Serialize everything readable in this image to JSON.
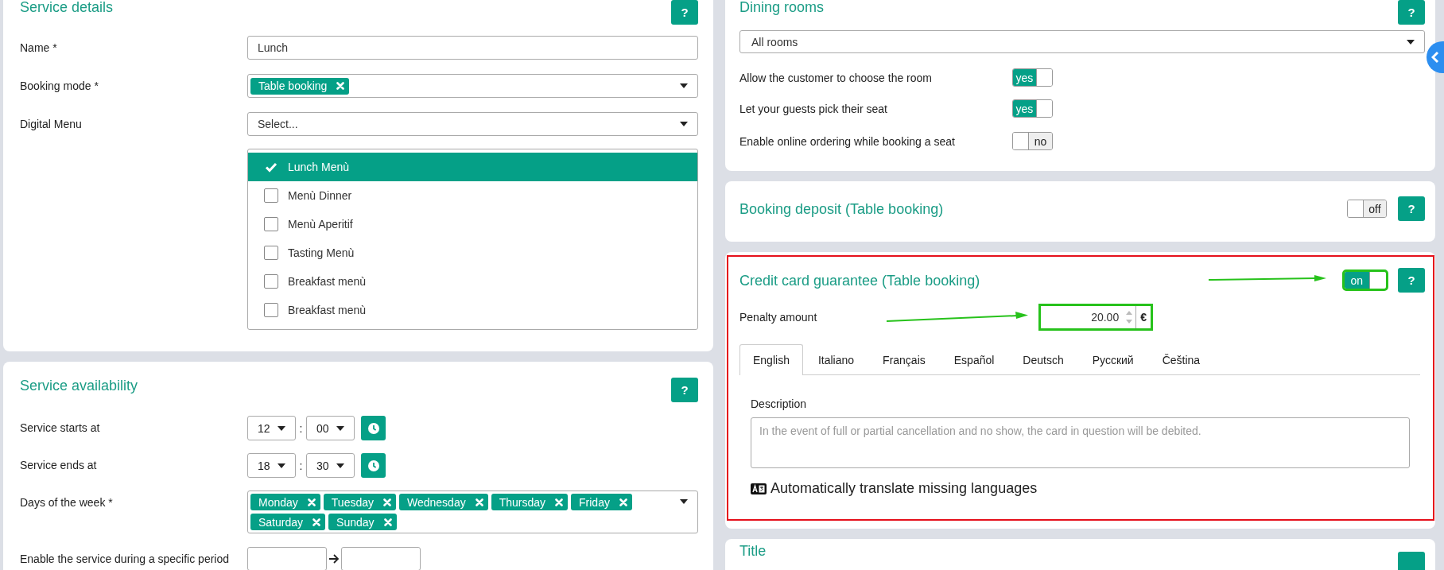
{
  "service_details": {
    "title": "Service details",
    "help": "?",
    "fields": [
      {
        "kind": "text",
        "label": "Name *",
        "value": "Lunch"
      },
      {
        "kind": "tags",
        "label": "Booking mode *",
        "tags": [
          "Table booking"
        ]
      },
      {
        "kind": "select",
        "label": "Digital Menu",
        "placeholder": "Select..."
      }
    ],
    "menus": [
      {
        "label": "Lunch Menù",
        "checked": true,
        "selected": true
      },
      {
        "label": "Menù Dinner",
        "checked": false,
        "selected": false
      },
      {
        "label": "Menù Aperitif",
        "checked": false,
        "selected": false
      },
      {
        "label": "Tasting Menù",
        "checked": false,
        "selected": false
      },
      {
        "label": "Breakfast menù",
        "checked": false,
        "selected": false
      },
      {
        "label": "Breakfast menù",
        "checked": false,
        "selected": false
      }
    ]
  },
  "service_availability": {
    "title": "Service availability",
    "help": "?",
    "times": [
      {
        "label": "Service starts at",
        "hour": "12",
        "separator": ":",
        "minute": "00"
      },
      {
        "label": "Service ends at",
        "hour": "18",
        "separator": ":",
        "minute": "30"
      }
    ],
    "days": {
      "label": "Days of the week *",
      "tags": [
        "Monday",
        "Tuesday",
        "Wednesday",
        "Thursday",
        "Friday",
        "Saturday",
        "Sunday"
      ]
    },
    "period": {
      "label": "Enable the service during a specific period"
    }
  },
  "dining_rooms": {
    "title": "Dining rooms",
    "help": "?",
    "select": "All rooms",
    "toggles": [
      {
        "label": "Allow the customer to choose the room",
        "on": true,
        "text": "yes"
      },
      {
        "label": "Let your guests pick their seat",
        "on": true,
        "text": "yes"
      },
      {
        "label": "Enable online ordering while booking a seat",
        "on": false,
        "text": "no"
      }
    ]
  },
  "booking_deposit": {
    "title": "Booking deposit (Table booking)",
    "toggle": {
      "on": false,
      "text": "off"
    },
    "help": "?"
  },
  "credit_card_guarantee": {
    "title": "Credit card guarantee (Table booking)",
    "toggle": {
      "on": true,
      "text": "on",
      "annotated": true
    },
    "help": "?",
    "penalty": {
      "label": "Penalty amount",
      "value": "20.00",
      "currency": "€",
      "annotated": true
    },
    "tabs": [
      {
        "label": "English",
        "selected": true
      },
      {
        "label": "Italiano",
        "selected": false
      },
      {
        "label": "Français",
        "selected": false
      },
      {
        "label": "Español",
        "selected": false
      },
      {
        "label": "Deutsch",
        "selected": false
      },
      {
        "label": "Русский",
        "selected": false
      },
      {
        "label": "Čeština",
        "selected": false
      }
    ],
    "description": {
      "label": "Description",
      "placeholder": "In the event of full or partial cancellation and no show, the card in question will be debited."
    },
    "auto_translate": "Automatically translate missing languages"
  },
  "title_card": {
    "title": "Title"
  }
}
